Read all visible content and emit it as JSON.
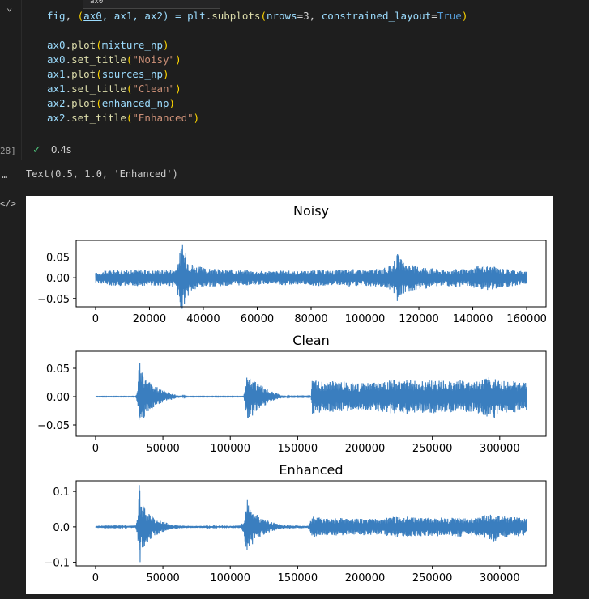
{
  "cell": {
    "chevron": "⌄",
    "execution_count": "28]",
    "tooltip_fragment": "ax0",
    "status_time": "0.4s",
    "status_icon": "check-icon"
  },
  "code": {
    "line1": {
      "a": "fig",
      "b": ", ",
      "c": "(",
      "d": "ax0",
      "e": ", ax1, ax2) = ",
      "f": "plt",
      "g": ".",
      "h": "subplots",
      "i": "(",
      "j": "nrows",
      "k": "=3, ",
      "l": "constrained_layout",
      "m": "=",
      "n": "True",
      "o": ")"
    },
    "calls": [
      {
        "obj": "ax0",
        "fn": "plot",
        "arg": "mixture_np",
        "is_str": false
      },
      {
        "obj": "ax0",
        "fn": "set_title",
        "arg": "\"Noisy\"",
        "is_str": true
      },
      {
        "obj": "ax1",
        "fn": "plot",
        "arg": "sources_np",
        "is_str": false
      },
      {
        "obj": "ax1",
        "fn": "set_title",
        "arg": "\"Clean\"",
        "is_str": true
      },
      {
        "obj": "ax2",
        "fn": "plot",
        "arg": "enhanced_np",
        "is_str": false
      },
      {
        "obj": "ax2",
        "fn": "set_title",
        "arg": "\"Enhanced\"",
        "is_str": true
      }
    ]
  },
  "output": {
    "dots": "…",
    "text": "Text(0.5, 1.0, 'Enhanced')",
    "icon": "</>"
  },
  "colors": {
    "line": "#3a7ebf",
    "accent_check": "#4ec47c"
  },
  "chart_data": [
    {
      "type": "line",
      "title": "Noisy",
      "xlabel": "",
      "ylabel": "",
      "x_range": [
        0,
        160000
      ],
      "ylim": [
        -0.07,
        0.09
      ],
      "xticks": [
        0,
        20000,
        40000,
        60000,
        80000,
        100000,
        120000,
        140000,
        160000
      ],
      "xtick_labels": [
        "0",
        "20000",
        "40000",
        "60000",
        "80000",
        "100000",
        "120000",
        "140000",
        "160000"
      ],
      "yticks": [
        0.05,
        0.0,
        -0.05
      ],
      "ytick_labels": [
        "0.05",
        "0.00",
        "−0.05"
      ],
      "series": [
        {
          "envelope": [
            [
              0,
              0.012
            ],
            [
              4000,
              0.018
            ],
            [
              8000,
              0.02
            ],
            [
              12000,
              0.019
            ],
            [
              16000,
              0.021
            ],
            [
              20000,
              0.018
            ],
            [
              24000,
              0.02
            ],
            [
              28000,
              0.022
            ],
            [
              30000,
              0.025
            ],
            [
              32000,
              0.085
            ],
            [
              33500,
              0.06
            ],
            [
              35000,
              0.038
            ],
            [
              38000,
              0.028
            ],
            [
              42000,
              0.022
            ],
            [
              48000,
              0.02
            ],
            [
              52000,
              0.02
            ],
            [
              58000,
              0.018
            ],
            [
              64000,
              0.016
            ],
            [
              70000,
              0.018
            ],
            [
              76000,
              0.016
            ],
            [
              82000,
              0.02
            ],
            [
              88000,
              0.018
            ],
            [
              94000,
              0.022
            ],
            [
              100000,
              0.02
            ],
            [
              106000,
              0.022
            ],
            [
              110000,
              0.03
            ],
            [
              112000,
              0.06
            ],
            [
              114000,
              0.04
            ],
            [
              118000,
              0.03
            ],
            [
              122000,
              0.028
            ],
            [
              126000,
              0.022
            ],
            [
              130000,
              0.02
            ],
            [
              134000,
              0.022
            ],
            [
              138000,
              0.02
            ],
            [
              142000,
              0.028
            ],
            [
              146000,
              0.03
            ],
            [
              150000,
              0.024
            ],
            [
              156000,
              0.02
            ],
            [
              160000,
              0.015
            ]
          ]
        }
      ]
    },
    {
      "type": "line",
      "title": "Clean",
      "xlabel": "",
      "ylabel": "",
      "x_range": [
        0,
        320000
      ],
      "ylim": [
        -0.07,
        0.08
      ],
      "xticks": [
        0,
        50000,
        100000,
        150000,
        200000,
        250000,
        300000
      ],
      "xtick_labels": [
        "0",
        "50000",
        "100000",
        "150000",
        "200000",
        "250000",
        "300000"
      ],
      "yticks": [
        0.05,
        0.0,
        -0.05
      ],
      "ytick_labels": [
        "0.05",
        "0.00",
        "−0.05"
      ],
      "series": [
        {
          "envelope": [
            [
              0,
              0.0005
            ],
            [
              30000,
              0.0005
            ],
            [
              31500,
              0.02
            ],
            [
              32500,
              0.075
            ],
            [
              34000,
              0.045
            ],
            [
              38000,
              0.03
            ],
            [
              44000,
              0.02
            ],
            [
              50000,
              0.012
            ],
            [
              56000,
              0.006
            ],
            [
              62000,
              0.002
            ],
            [
              68000,
              0.0005
            ],
            [
              110000,
              0.0005
            ],
            [
              111500,
              0.025
            ],
            [
              112500,
              0.05
            ],
            [
              115000,
              0.038
            ],
            [
              120000,
              0.025
            ],
            [
              126000,
              0.015
            ],
            [
              132000,
              0.008
            ],
            [
              138000,
              0.003
            ],
            [
              144000,
              0.0008
            ],
            [
              160000,
              0.0008
            ],
            [
              161000,
              0.035
            ],
            [
              164000,
              0.03
            ],
            [
              170000,
              0.026
            ],
            [
              180000,
              0.028
            ],
            [
              190000,
              0.025
            ],
            [
              200000,
              0.024
            ],
            [
              210000,
              0.026
            ],
            [
              220000,
              0.03
            ],
            [
              230000,
              0.032
            ],
            [
              240000,
              0.028
            ],
            [
              250000,
              0.03
            ],
            [
              260000,
              0.028
            ],
            [
              270000,
              0.03
            ],
            [
              280000,
              0.026
            ],
            [
              290000,
              0.035
            ],
            [
              295000,
              0.04
            ],
            [
              300000,
              0.03
            ],
            [
              310000,
              0.028
            ],
            [
              320000,
              0.025
            ]
          ]
        }
      ]
    },
    {
      "type": "line",
      "title": "Enhanced",
      "xlabel": "",
      "ylabel": "",
      "x_range": [
        0,
        320000
      ],
      "ylim": [
        -0.11,
        0.13
      ],
      "xticks": [
        0,
        50000,
        100000,
        150000,
        200000,
        250000,
        300000
      ],
      "xtick_labels": [
        "0",
        "50000",
        "100000",
        "150000",
        "200000",
        "250000",
        "300000"
      ],
      "yticks": [
        0.1,
        0.0,
        -0.1
      ],
      "ytick_labels": [
        "0.1",
        "0.0",
        "−0.1"
      ],
      "series": [
        {
          "envelope": [
            [
              0,
              0.001
            ],
            [
              20000,
              0.002
            ],
            [
              30000,
              0.004
            ],
            [
              31500,
              0.05
            ],
            [
              32500,
              0.12
            ],
            [
              34000,
              0.07
            ],
            [
              38000,
              0.045
            ],
            [
              44000,
              0.025
            ],
            [
              50000,
              0.015
            ],
            [
              56000,
              0.008
            ],
            [
              62000,
              0.004
            ],
            [
              70000,
              0.003
            ],
            [
              80000,
              0.003
            ],
            [
              90000,
              0.002
            ],
            [
              100000,
              0.003
            ],
            [
              108000,
              0.004
            ],
            [
              110000,
              0.02
            ],
            [
              112500,
              0.085
            ],
            [
              115000,
              0.06
            ],
            [
              120000,
              0.035
            ],
            [
              126000,
              0.02
            ],
            [
              132000,
              0.012
            ],
            [
              138000,
              0.006
            ],
            [
              148000,
              0.004
            ],
            [
              158000,
              0.003
            ],
            [
              161000,
              0.03
            ],
            [
              164000,
              0.028
            ],
            [
              170000,
              0.024
            ],
            [
              180000,
              0.026
            ],
            [
              190000,
              0.022
            ],
            [
              200000,
              0.024
            ],
            [
              210000,
              0.022
            ],
            [
              220000,
              0.028
            ],
            [
              230000,
              0.03
            ],
            [
              240000,
              0.026
            ],
            [
              250000,
              0.028
            ],
            [
              260000,
              0.026
            ],
            [
              270000,
              0.028
            ],
            [
              280000,
              0.024
            ],
            [
              290000,
              0.035
            ],
            [
              295000,
              0.045
            ],
            [
              300000,
              0.03
            ],
            [
              310000,
              0.028
            ],
            [
              320000,
              0.024
            ]
          ]
        }
      ]
    }
  ]
}
